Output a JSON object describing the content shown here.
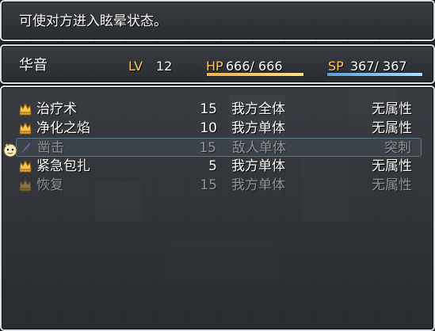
{
  "help": {
    "text": "可使对方进入眩晕状态。"
  },
  "actor": {
    "name": "华音",
    "lv_label": "LV",
    "lv": "12",
    "hp_label": "HP",
    "hp_text": "666/ 666",
    "hp_fraction": 1.0,
    "sp_label": "SP",
    "sp_text": "367/ 367",
    "sp_fraction": 1.0
  },
  "skills": [
    {
      "name": "治疗术",
      "cost": "15",
      "target": "我方全体",
      "attr": "无属性",
      "icon": "crown-icon",
      "enabled": true,
      "selected": false
    },
    {
      "name": "净化之焰",
      "cost": "10",
      "target": "我方单体",
      "attr": "无属性",
      "icon": "crown-icon",
      "enabled": true,
      "selected": false
    },
    {
      "name": "凿击",
      "cost": "15",
      "target": "敌人单体",
      "attr": "突刺",
      "icon": "sword-icon",
      "enabled": false,
      "selected": true
    },
    {
      "name": "紧急包扎",
      "cost": "5",
      "target": "我方单体",
      "attr": "无属性",
      "icon": "crown-icon",
      "enabled": true,
      "selected": false
    },
    {
      "name": "恢复",
      "cost": "15",
      "target": "我方单体",
      "attr": "无属性",
      "icon": "crown-icon",
      "enabled": false,
      "selected": false
    }
  ],
  "colors": {
    "system": "#ffcc55",
    "window_border": "#d8dde4",
    "selection": "#8fc4e0"
  }
}
